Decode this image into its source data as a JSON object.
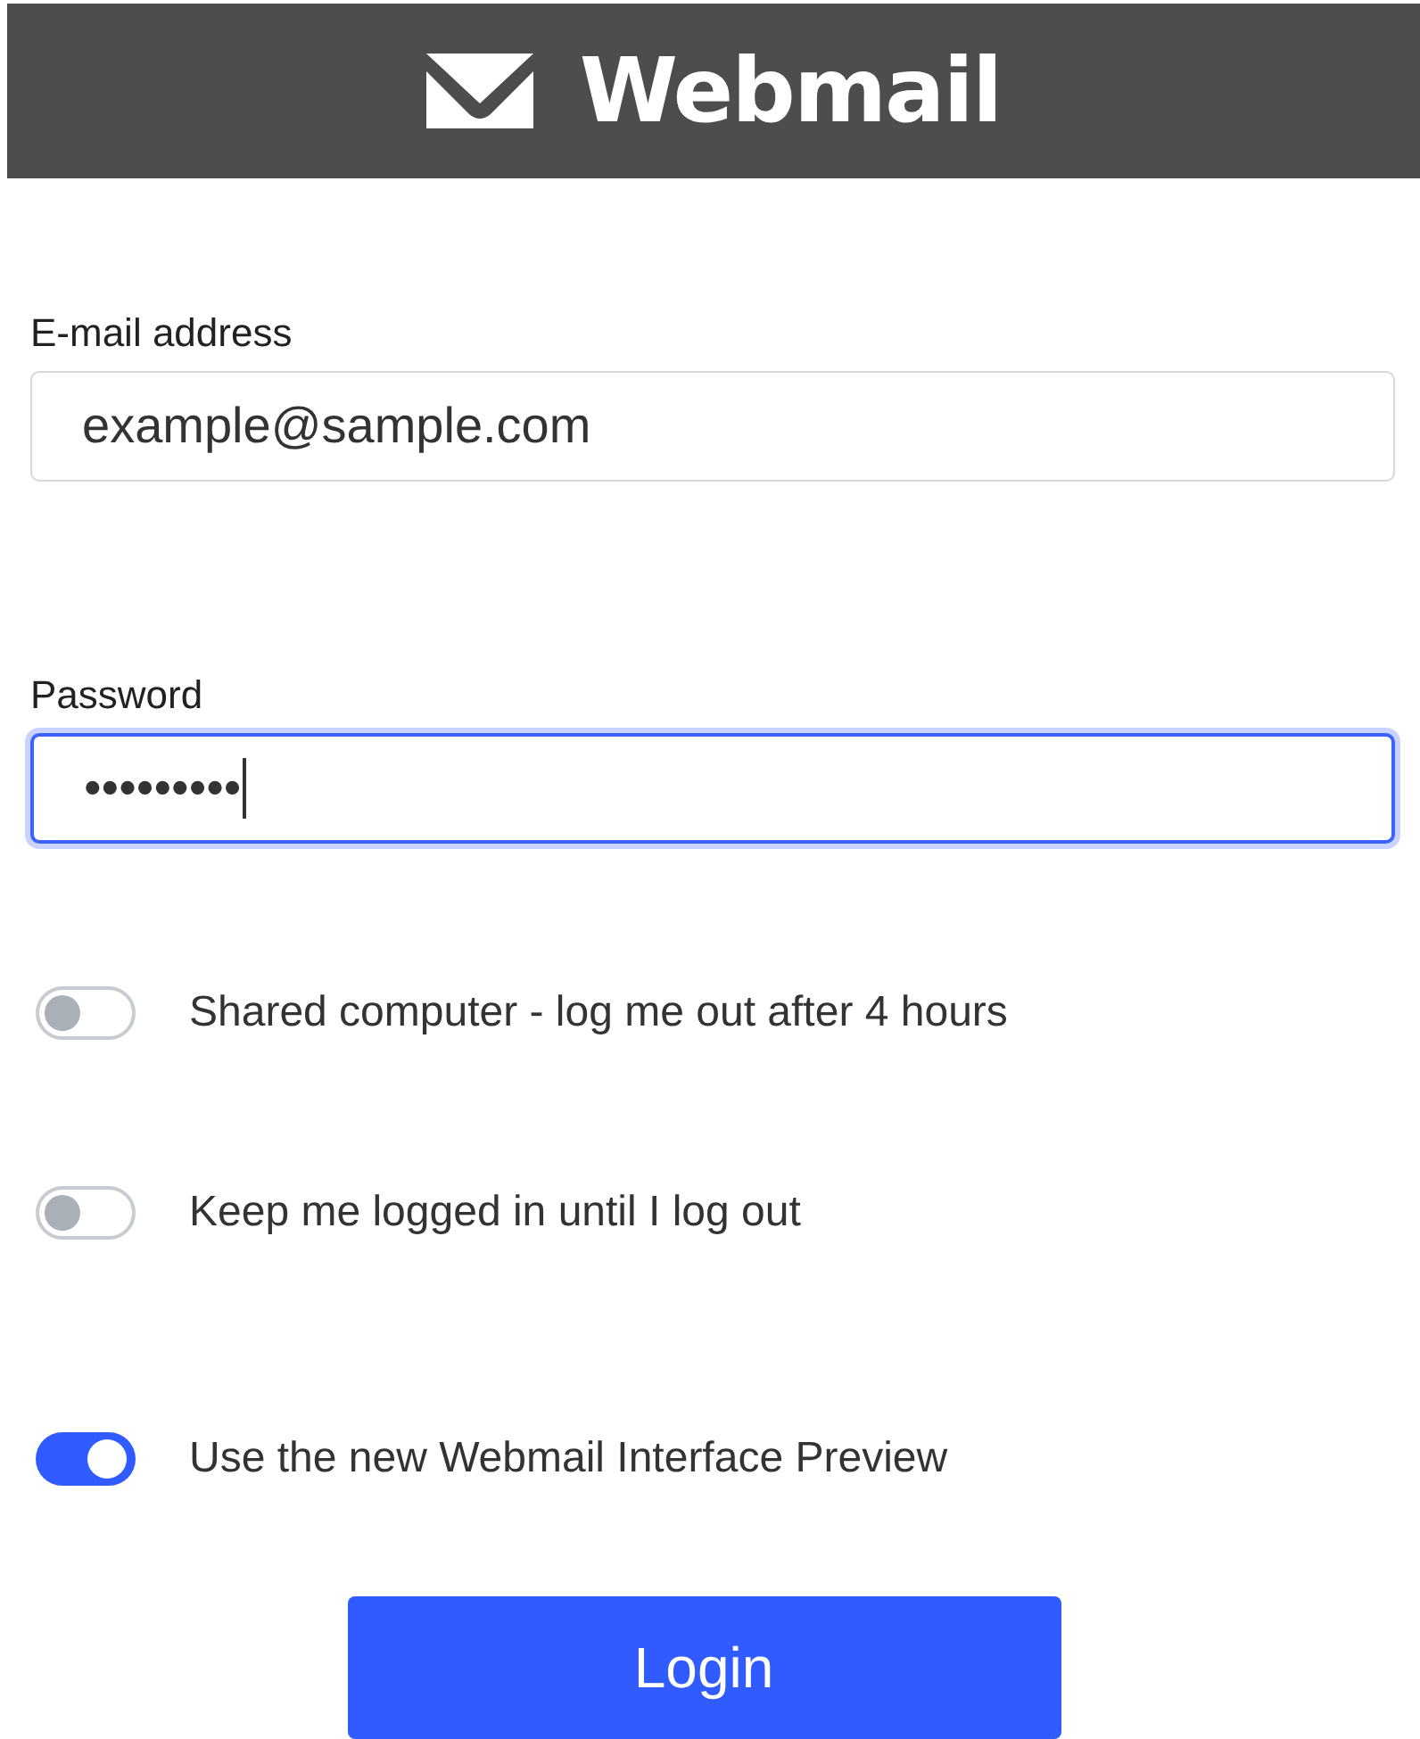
{
  "header": {
    "title": "Webmail"
  },
  "fields": [
    {
      "label": "E-mail address",
      "value": "example@sample.com",
      "focused": false
    },
    {
      "label": "Password",
      "value": "•••••••••",
      "focused": true
    }
  ],
  "toggles": [
    {
      "label": "Shared computer - log me out after 4 hours",
      "on": false
    },
    {
      "label": "Keep me logged in until I log out",
      "on": false
    },
    {
      "label": "Use the new Webmail Interface Preview",
      "on": true
    }
  ],
  "button": {
    "label": "Login"
  }
}
